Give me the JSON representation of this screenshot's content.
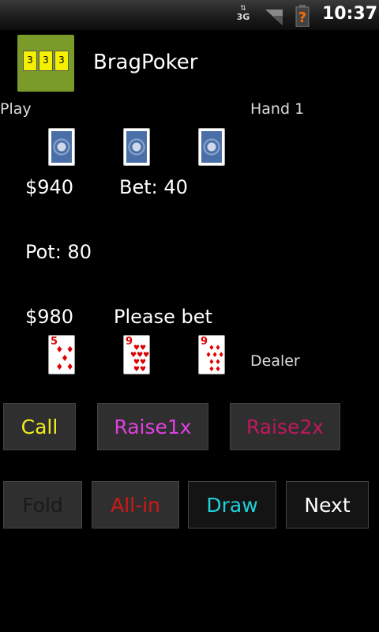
{
  "status": {
    "network": "3G",
    "time": "10:37"
  },
  "app": {
    "title": "BragPoker",
    "icon_cards": [
      "3",
      "3",
      "3"
    ]
  },
  "table": {
    "mode": "Play",
    "hand": "Hand 1",
    "opponent": {
      "money": "$940",
      "bet": "Bet: 40"
    },
    "pot": "Pot: 80",
    "player": {
      "money": "$980",
      "status": "Please bet",
      "role": "Dealer",
      "cards": [
        {
          "rank": "5",
          "suit": "♦",
          "pips": "♦ ♦\n♦\n♦ ♦"
        },
        {
          "rank": "9",
          "suit": "♥",
          "pips": "♥♥\n♥♥♥\n♥♥\n♥♥"
        },
        {
          "rank": "9",
          "suit": "♦",
          "pips": "♦♦\n♦♦♦\n♦♦\n♦♦"
        }
      ]
    }
  },
  "buttons": {
    "call": "Call",
    "raise1x": "Raise1x",
    "raise2x": "Raise2x",
    "fold": "Fold",
    "allin": "All-in",
    "draw": "Draw",
    "next": "Next"
  },
  "colors": {
    "call": "#f0ec20",
    "raise1x": "#e040e0",
    "raise2x": "#c0185c",
    "fold": "#1a1a1a",
    "allin": "#d01818",
    "draw": "#20d0d8",
    "next": "#ffffff"
  }
}
